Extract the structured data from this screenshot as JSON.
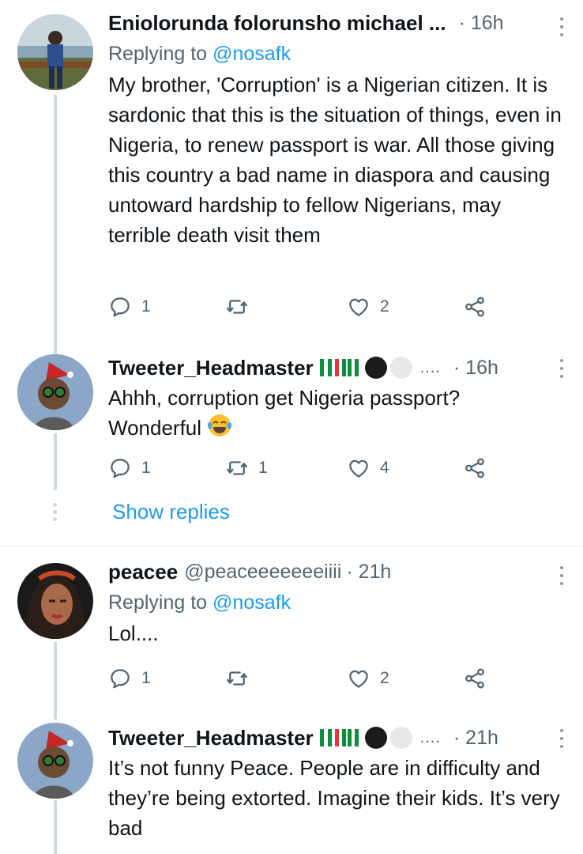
{
  "tweets": [
    {
      "name": "Eniolorunda folorunsho michael ...",
      "time": "· 16h",
      "replying_prefix": "Replying to ",
      "replying_handle": "@nosafk",
      "text": "My brother, 'Corruption' is a Nigerian citizen. It is sardonic that this is the situation of things, even in Nigeria, to renew passport is war. All those giving this country a bad name in diaspora and causing untoward hardship to fellow Nigerians, may terrible death visit them",
      "replies": "1",
      "retweets": "",
      "likes": "2"
    },
    {
      "name": "Tweeter_Headmaster",
      "ellipsis": "....",
      "time": "· 16h",
      "text_line1": "Ahhh, corruption get Nigeria passport?",
      "text_line2": "Wonderful",
      "replies": "1",
      "retweets": "1",
      "likes": "4",
      "show_replies": "Show replies"
    },
    {
      "name": "peacee",
      "handle": "@peaceeeeeeeiiii",
      "time": "· 21h",
      "replying_prefix": "Replying to ",
      "replying_handle": "@nosafk",
      "text": "Lol....",
      "replies": "1",
      "retweets": "",
      "likes": "2"
    },
    {
      "name": "Tweeter_Headmaster",
      "ellipsis": "....",
      "time": "· 21h",
      "text": "It’s not funny Peace. People are in difficulty and they’re being extorted. Imagine their kids. It’s very bad"
    }
  ],
  "colors": {
    "link": "#1d9bf0",
    "secondary_text": "#536471",
    "thread_line": "#cfd9de"
  },
  "icons": [
    "reply-icon",
    "retweet-icon",
    "like-icon",
    "share-icon",
    "more-icon"
  ]
}
